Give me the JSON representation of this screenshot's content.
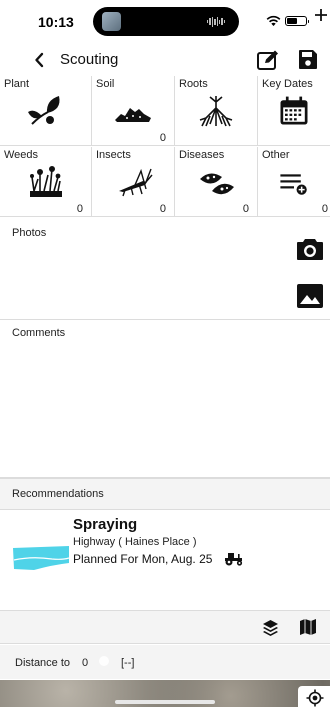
{
  "status": {
    "time": "10:13"
  },
  "nav": {
    "back_icon": "chevron-left-icon",
    "title": "Scouting",
    "edit_icon": "edit-note-icon",
    "save_icon": "floppy-disk-icon"
  },
  "grid": {
    "row1": [
      {
        "label": "Plant",
        "icon": "plant-icon",
        "count": ""
      },
      {
        "label": "Soil",
        "icon": "soil-icon",
        "count": "0"
      },
      {
        "label": "Roots",
        "icon": "roots-icon",
        "count": ""
      },
      {
        "label": "Key Dates",
        "icon": "calendar-icon",
        "count": ""
      }
    ],
    "row2": [
      {
        "label": "Weeds",
        "icon": "weeds-icon",
        "count": "0"
      },
      {
        "label": "Insects",
        "icon": "grasshopper-icon",
        "count": "0"
      },
      {
        "label": "Diseases",
        "icon": "diseased-leaf-icon",
        "count": "0"
      },
      {
        "label": "Other",
        "icon": "list-add-icon",
        "count": "0"
      }
    ]
  },
  "photos": {
    "label": "Photos",
    "camera_icon": "camera-icon",
    "gallery_icon": "image-icon"
  },
  "comments": {
    "label": "Comments"
  },
  "recommendations": {
    "label": "Recommendations",
    "add_icon": "plus-icon",
    "item": {
      "title": "Spraying",
      "field": "Highway ( Haines Place )",
      "planned": "Planned For Mon, Aug. 25",
      "icon": "tractor-icon"
    }
  },
  "map_toolbar": {
    "layers_icon": "layers-icon",
    "map_icon": "map-icon"
  },
  "distance": {
    "label": "Distance to",
    "value": "0",
    "unknown": "[--]"
  },
  "colors": {
    "field_fill": "#4fd3e8",
    "accent": "#111111",
    "toolbar_bg": "#f4f4f4"
  }
}
